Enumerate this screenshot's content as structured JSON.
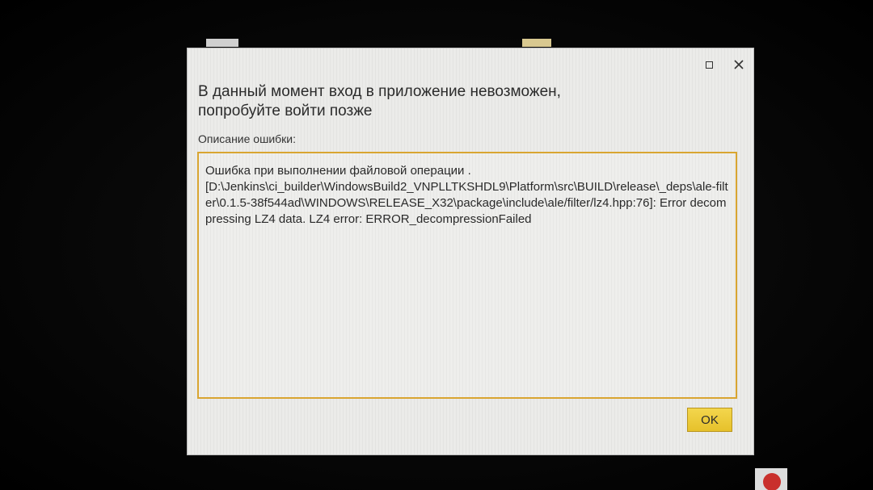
{
  "dialog": {
    "title_line1": "В данный момент вход в приложение невозможен,",
    "title_line2": "попробуйте войти позже",
    "description_label": "Описание ошибки:",
    "error_text": "Ошибка при выполнении файловой операции .\n[D:\\Jenkins\\ci_builder\\WindowsBuild2_VNPLLTKSHDL9\\Platform\\src\\BUILD\\release\\_deps\\ale-filter\\0.1.5-38f544ad\\WINDOWS\\RELEASE_X32\\package\\include\\ale/filter/lz4.hpp:76]: Error decompressing LZ4 data. LZ4 error: ERROR_decompressionFailed",
    "ok_label": "OK",
    "buttons": {
      "maximize_icon": "maximize-icon",
      "close_icon": "close-icon"
    }
  },
  "colors": {
    "dialog_bg": "#ebebe9",
    "error_border": "#d9a531",
    "ok_button": "#e6c12b",
    "screen_bg": "#050505"
  }
}
